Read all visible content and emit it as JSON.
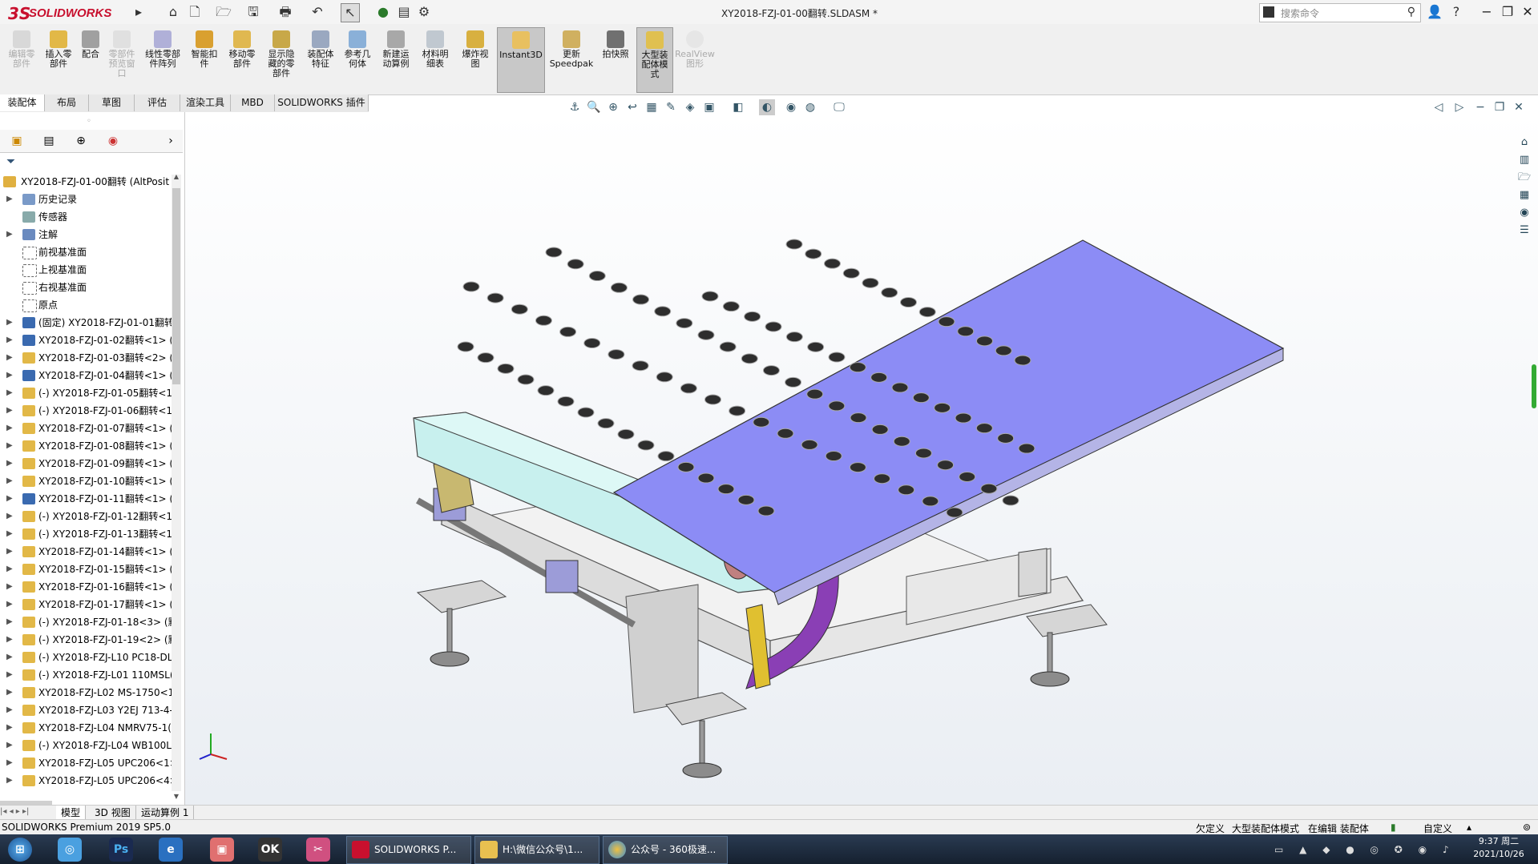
{
  "app": {
    "logo_ds": "3S",
    "logo_text": "SOLIDWORKS",
    "document_title": "XY2018-FZJ-01-00翻转.SLDASM *",
    "search_placeholder": "搜索命令",
    "win_buttons": [
      "−",
      "❐",
      "✕"
    ]
  },
  "quick_access": [
    "⌂",
    "🗋",
    "📂",
    "💾",
    "🖶",
    "↶",
    "↖",
    "⚙"
  ],
  "ribbon": {
    "buttons": [
      {
        "label": "编辑零\n部件",
        "disabled": true
      },
      {
        "label": "插入零\n部件",
        "disabled": false
      },
      {
        "label": "配合",
        "disabled": false
      },
      {
        "label": "零部件\n预览窗\n口",
        "disabled": true
      },
      {
        "label": "线性零部\n件阵列",
        "disabled": false
      },
      {
        "label": "智能扣\n件",
        "disabled": false
      },
      {
        "label": "移动零\n部件",
        "disabled": false
      },
      {
        "label": "显示隐\n藏的零\n部件",
        "disabled": false
      },
      {
        "label": "装配体\n特征",
        "disabled": false
      },
      {
        "label": "参考几\n何体",
        "disabled": false
      },
      {
        "label": "新建运\n动算例",
        "disabled": false
      },
      {
        "label": "材料明\n细表",
        "disabled": false
      },
      {
        "label": "爆炸视\n图",
        "disabled": false
      },
      {
        "label": "Instant3D",
        "disabled": false,
        "active": true
      },
      {
        "label": "更新\nSpeedpak",
        "disabled": false
      },
      {
        "label": "拍快照",
        "disabled": false
      },
      {
        "label": "大型装\n配体模\n式",
        "disabled": false,
        "active": true
      },
      {
        "label": "RealView\n图形",
        "disabled": true
      }
    ]
  },
  "command_tabs": [
    "装配体",
    "布局",
    "草图",
    "评估",
    "渲染工具",
    "MBD",
    "SOLIDWORKS 插件"
  ],
  "feature_tree": {
    "root": "XY2018-FZJ-01-00翻转  (AltPosit",
    "items": [
      {
        "label": "历史记录",
        "icon": "history-icon",
        "expand": "▶"
      },
      {
        "label": "传感器",
        "icon": "sensor-icon",
        "expand": ""
      },
      {
        "label": "注解",
        "icon": "annotation-icon",
        "expand": "▶"
      },
      {
        "label": "前视基准面",
        "icon": "plane-icon",
        "expand": ""
      },
      {
        "label": "上视基准面",
        "icon": "plane-icon",
        "expand": ""
      },
      {
        "label": "右视基准面",
        "icon": "plane-icon",
        "expand": ""
      },
      {
        "label": "原点",
        "icon": "origin-icon",
        "expand": ""
      },
      {
        "label": "(固定) XY2018-FZJ-01-01翻转",
        "icon": "subassembly-icon",
        "expand": "▶"
      },
      {
        "label": "XY2018-FZJ-01-02翻转<1> (",
        "icon": "subassembly-icon",
        "expand": "▶"
      },
      {
        "label": "XY2018-FZJ-01-03翻转<2> (",
        "icon": "part-icon",
        "expand": "▶"
      },
      {
        "label": "XY2018-FZJ-01-04翻转<1> (",
        "icon": "subassembly-icon",
        "expand": "▶"
      },
      {
        "label": "(-) XY2018-FZJ-01-05翻转<1",
        "icon": "part-icon",
        "expand": "▶"
      },
      {
        "label": "(-) XY2018-FZJ-01-06翻转<1",
        "icon": "part-icon",
        "expand": "▶"
      },
      {
        "label": "XY2018-FZJ-01-07翻转<1> (",
        "icon": "part-icon",
        "expand": "▶"
      },
      {
        "label": "XY2018-FZJ-01-08翻转<1> (",
        "icon": "part-icon",
        "expand": "▶"
      },
      {
        "label": "XY2018-FZJ-01-09翻转<1> (",
        "icon": "part-icon",
        "expand": "▶"
      },
      {
        "label": "XY2018-FZJ-01-10翻转<1> (",
        "icon": "part-icon",
        "expand": "▶"
      },
      {
        "label": "XY2018-FZJ-01-11翻转<1> (",
        "icon": "subassembly-icon",
        "expand": "▶"
      },
      {
        "label": "(-) XY2018-FZJ-01-12翻转<1",
        "icon": "part-icon",
        "expand": "▶"
      },
      {
        "label": "(-) XY2018-FZJ-01-13翻转<1",
        "icon": "part-icon",
        "expand": "▶"
      },
      {
        "label": "XY2018-FZJ-01-14翻转<1> (",
        "icon": "part-icon",
        "expand": "▶"
      },
      {
        "label": "XY2018-FZJ-01-15翻转<1> (",
        "icon": "part-icon",
        "expand": "▶"
      },
      {
        "label": "XY2018-FZJ-01-16翻转<1> (",
        "icon": "part-icon",
        "expand": "▶"
      },
      {
        "label": "XY2018-FZJ-01-17翻转<1> (",
        "icon": "part-icon",
        "expand": "▶"
      },
      {
        "label": "(-) XY2018-FZJ-01-18<3> (默",
        "icon": "part-icon",
        "expand": "▶"
      },
      {
        "label": "(-) XY2018-FZJ-01-19<2> (默",
        "icon": "part-icon",
        "expand": "▶"
      },
      {
        "label": "(-) XY2018-FZJ-L10 PC18-DL",
        "icon": "part-icon",
        "expand": "▶"
      },
      {
        "label": "(-) XY2018-FZJ-L01 110MSL(",
        "icon": "part-icon",
        "expand": "▶"
      },
      {
        "label": "XY2018-FZJ-L02 MS-1750<1",
        "icon": "part-icon",
        "expand": "▶"
      },
      {
        "label": "XY2018-FZJ-L03 Y2EJ 713-4-",
        "icon": "part-icon",
        "expand": "▶"
      },
      {
        "label": "XY2018-FZJ-L04 NMRV75-1(",
        "icon": "part-icon",
        "expand": "▶"
      },
      {
        "label": "(-) XY2018-FZJ-L04 WB100LI",
        "icon": "part-icon",
        "expand": "▶"
      },
      {
        "label": "XY2018-FZJ-L05 UPC206<1>",
        "icon": "part-icon",
        "expand": "▶"
      },
      {
        "label": "XY2018-FZJ-L05 UPC206<4>",
        "icon": "part-icon",
        "expand": "▶"
      }
    ]
  },
  "bottom_tabs": [
    "模型",
    "3D 视图",
    "运动算例 1"
  ],
  "status_bar": {
    "left": "SOLIDWORKS Premium 2019 SP5.0",
    "defined": "欠定义",
    "mode": "大型装配体模式",
    "editing": "在编辑 装配体",
    "custom": "自定义"
  },
  "taskbar": {
    "tasks": [
      {
        "label": "SOLIDWORKS P...",
        "color": "#c8102e"
      },
      {
        "label": "H:\\微信公众号\\1...",
        "color": "#e8c050"
      },
      {
        "label": "公众号 - 360极速...",
        "color": "#3a8fd8"
      }
    ],
    "time": "9:37 周二",
    "date": "2021/10/26"
  },
  "colors": {
    "plate": "#8c8cf5",
    "frame": "#e4e4e4",
    "bracket": "#c8f0ee",
    "purple_part": "#8a3fb5"
  }
}
